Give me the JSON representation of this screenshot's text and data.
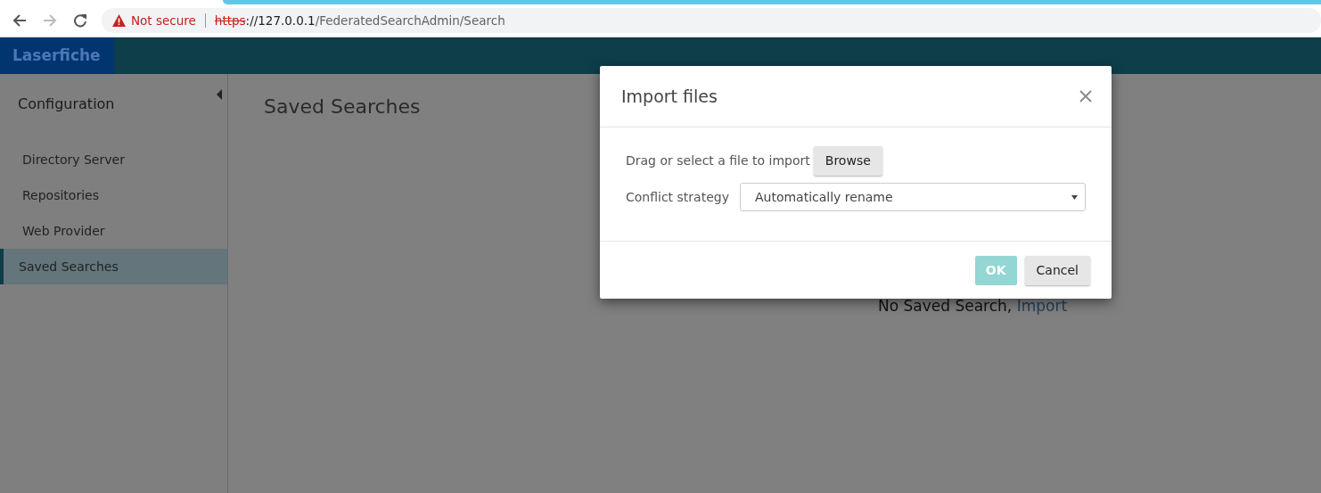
{
  "browser": {
    "forward_disabled": true,
    "security": "Not secure",
    "url_scheme": "https",
    "url_host": "://127.0.0.1",
    "url_path": "/FederatedSearchAdmin/Search"
  },
  "header": {
    "logo": "Laserfiche"
  },
  "sidebar": {
    "title": "Configuration",
    "items": [
      {
        "label": "Directory Server",
        "selected": false
      },
      {
        "label": "Repositories",
        "selected": false
      },
      {
        "label": "Web Provider",
        "selected": false
      },
      {
        "label": "Saved Searches",
        "selected": true
      }
    ]
  },
  "main": {
    "title": "Saved Searches",
    "empty_text": "No Saved Search,",
    "empty_link": "Import"
  },
  "dialog": {
    "title": "Import files",
    "file_label": "Drag or select a file to import",
    "browse": "Browse",
    "conflict_label": "Conflict strategy",
    "conflict_value": "Automatically rename",
    "buttons": [
      {
        "label": "OK",
        "kind": "primary",
        "disabled": true
      },
      {
        "label": "Cancel",
        "kind": "secondary",
        "disabled": false
      }
    ]
  }
}
